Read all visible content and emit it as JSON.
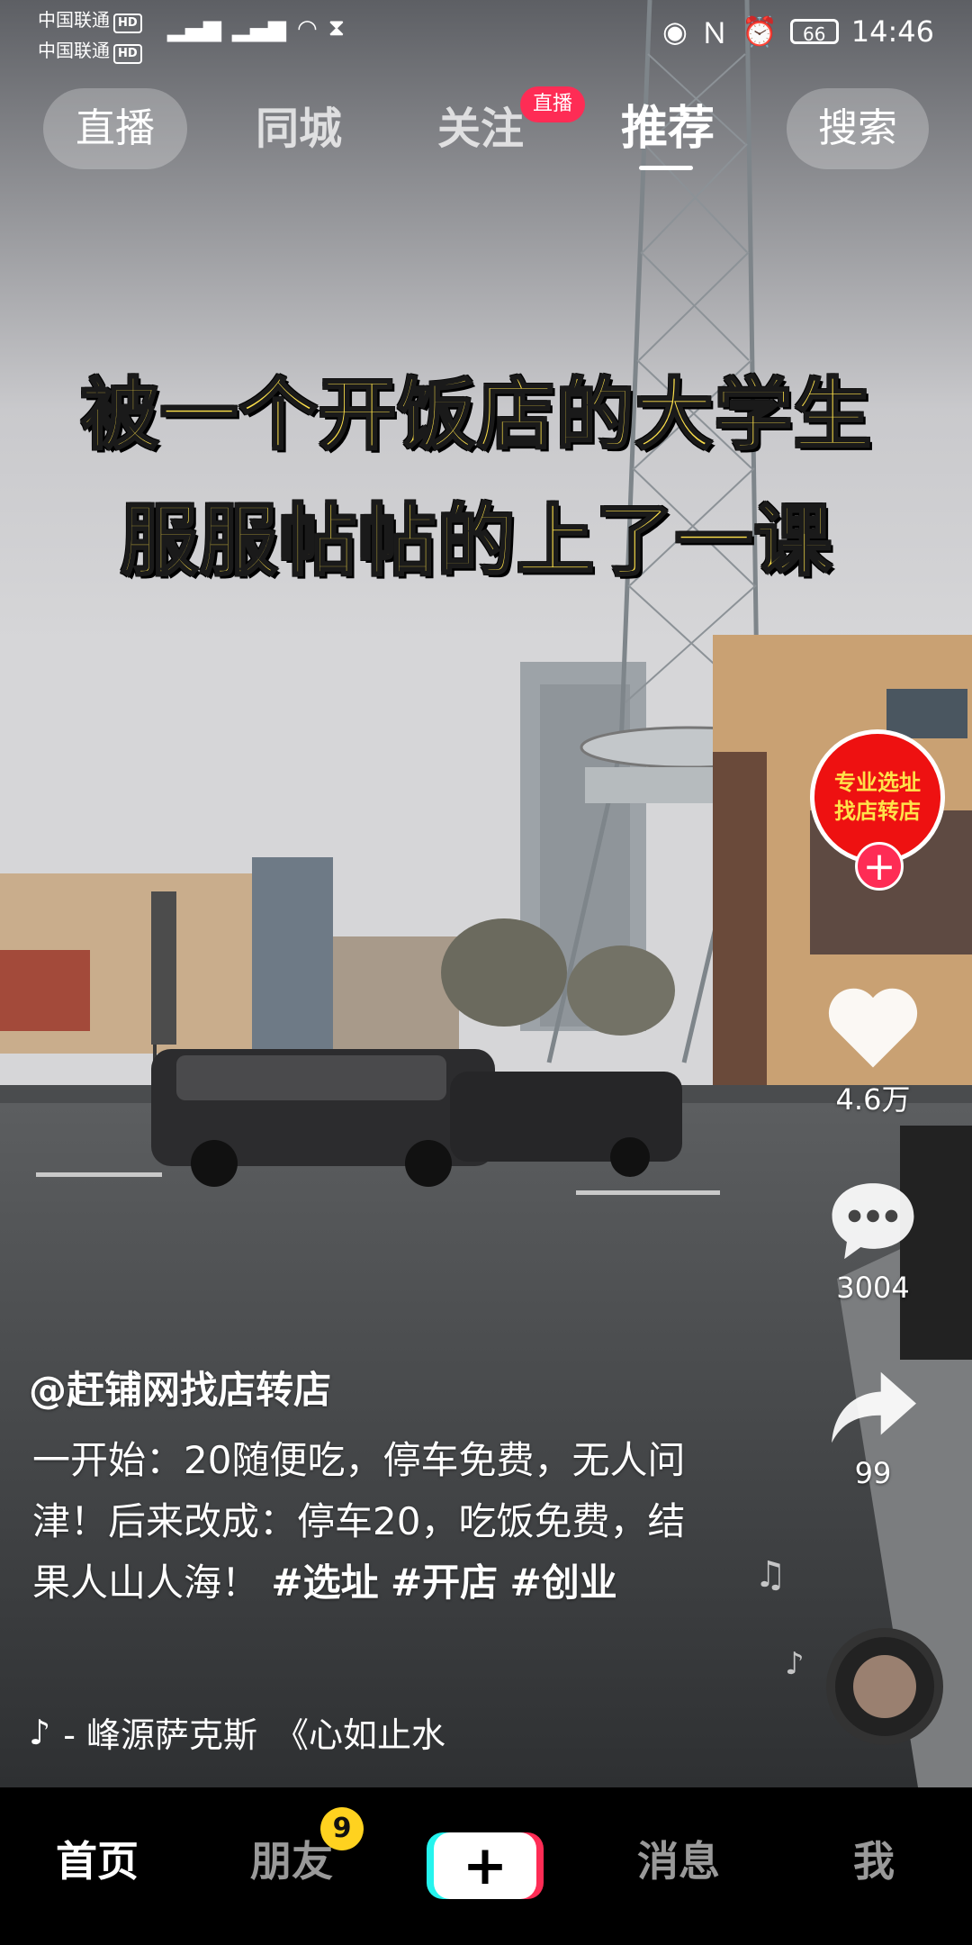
{
  "status_bar": {
    "carrier_1": "中国联通",
    "carrier_2": "中国联通",
    "hd": "HD",
    "battery": "66",
    "time": "14:46"
  },
  "top_nav": {
    "live": "直播",
    "city": "同城",
    "follow": "关注",
    "follow_badge": "直播",
    "recommend": "推荐",
    "search": "搜索"
  },
  "video": {
    "caption_line_1": "被一个开饭店的大学生",
    "caption_line_2": "服服帖帖的上了一课"
  },
  "creator": {
    "avatar_line_1": "专业选址",
    "avatar_line_2": "找店转店"
  },
  "actions": {
    "likes": "4.6万",
    "comments": "3004",
    "shares": "99"
  },
  "post": {
    "author": "@赶铺网找店转店",
    "description": "一开始：20随便吃，停车免费，无人问津！后来改成：停车20，吃饭免费，结果人山人海！",
    "tags": [
      "#选址",
      "#开店",
      "#创业"
    ],
    "music": "- 峰源萨克斯　《心如止水"
  },
  "bottom_nav": {
    "home": "首页",
    "friends": "朋友",
    "friends_badge": "9",
    "create": "+",
    "messages": "消息",
    "me": "我"
  },
  "colors": {
    "accent_red": "#fe2c55",
    "accent_cyan": "#25f4ee",
    "caption_yellow": "#ffe24a",
    "badge_yellow": "#ffd21f"
  }
}
